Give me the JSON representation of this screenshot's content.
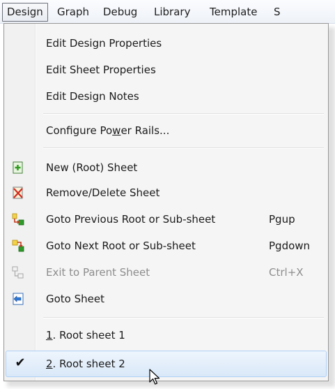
{
  "menubar": {
    "items": [
      "Design",
      "Graph",
      "Debug",
      "Library",
      "Template",
      "S"
    ]
  },
  "menu": {
    "edit_design_properties": "Edit Design Properties",
    "edit_sheet_properties": "Edit Sheet Properties",
    "edit_design_notes": "Edit Design Notes",
    "configure_power_rails": {
      "before": "Configure Po",
      "mnemonic": "w",
      "after": "er Rails..."
    },
    "new_root_sheet": "New (Root) Sheet",
    "remove_delete_sheet": "Remove/Delete Sheet",
    "goto_previous": {
      "label": "Goto Previous Root or Sub-sheet",
      "shortcut": "Pgup"
    },
    "goto_next": {
      "label": "Goto Next Root or Sub-sheet",
      "shortcut": "Pgdown"
    },
    "exit_to_parent": {
      "label": "Exit to Parent Sheet",
      "shortcut": "Ctrl+X",
      "disabled": true
    },
    "goto_sheet": "Goto Sheet",
    "root_sheet_1": {
      "mnemonic": "1",
      "rest": ". Root sheet 1"
    },
    "root_sheet_2": {
      "mnemonic": "2",
      "rest": ". Root sheet 2",
      "checked": true,
      "check_glyph": "✔"
    }
  },
  "icons": {
    "new_sheet": "new-sheet-icon",
    "remove_sheet": "remove-sheet-icon",
    "goto_previous": "goto-previous-icon",
    "goto_next": "goto-next-icon",
    "exit_parent": "exit-parent-icon",
    "goto_sheet": "goto-sheet-icon"
  },
  "colors": {
    "highlight_border": "#aecff7",
    "highlight_fill": "#d9e8f8",
    "disabled_text": "#8d8d8d"
  }
}
